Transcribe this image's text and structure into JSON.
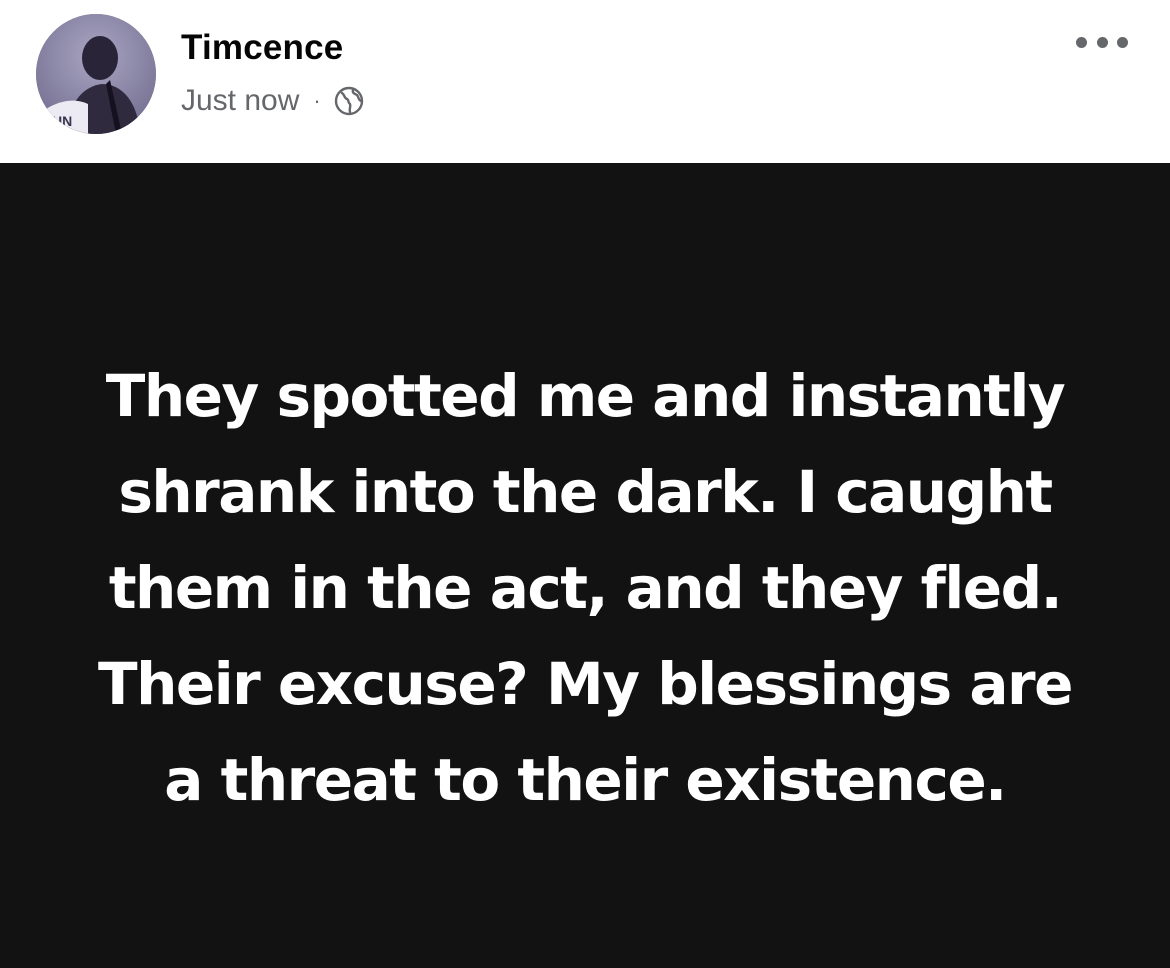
{
  "post": {
    "author": {
      "name": "Timcence",
      "avatar_icon": "profile-photo"
    },
    "timestamp": "Just now",
    "separator": "·",
    "privacy_icon": "globe-icon",
    "more_icon": "more-options-icon",
    "text": "They spotted me and instantly shrank into the dark. I caught them in the act, and they fled. Their excuse? My blessings are a threat to their existence.",
    "colors": {
      "background": "#121212",
      "text": "#ffffff",
      "meta": "#65676b"
    }
  }
}
